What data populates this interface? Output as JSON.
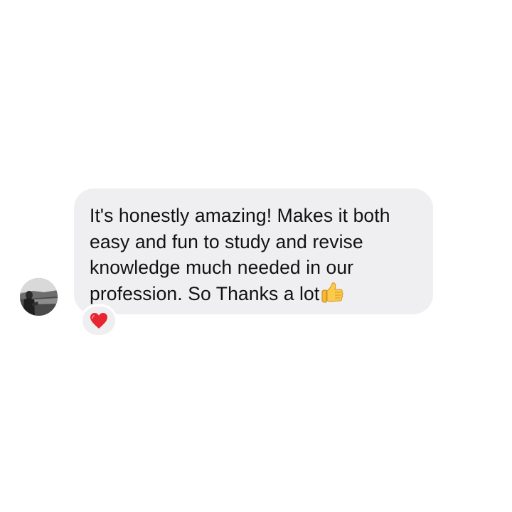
{
  "message": {
    "text": "It's honestly amazing! Makes it both\neasy and fun to study and revise\nknowledge much needed in our\nprofession. So Thanks a lot",
    "trailing_emoji": "thumbs-up-icon",
    "bubble_color": "#efeff2",
    "text_color": "#111111"
  },
  "avatar": {
    "icon": "user-avatar-photo"
  },
  "reaction": {
    "icon": "heart-icon",
    "color": "#e8262f"
  }
}
